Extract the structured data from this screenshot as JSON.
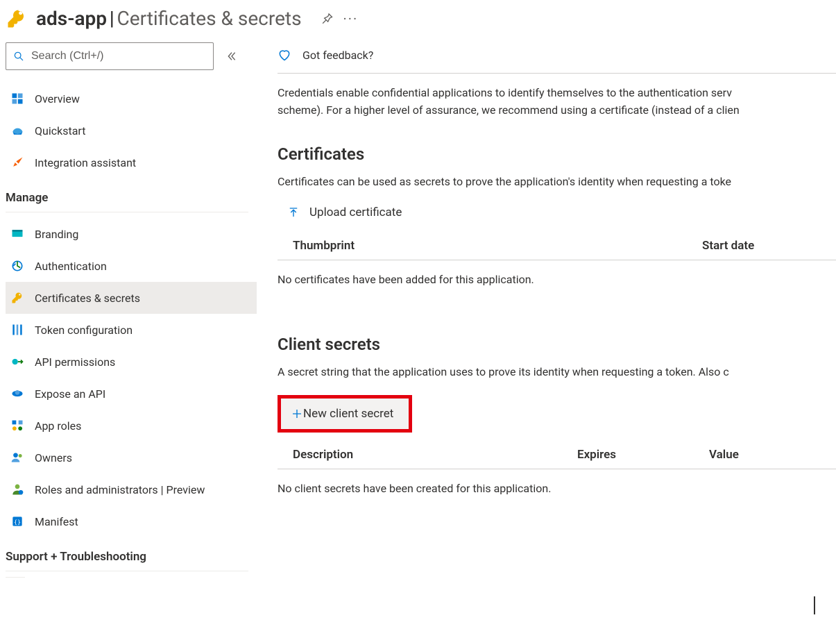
{
  "header": {
    "app_name": "ads-app",
    "page_title": "Certificates & secrets"
  },
  "sidebar": {
    "search_placeholder": "Search (Ctrl+/)",
    "top_items": [
      {
        "label": "Overview",
        "icon": "overview"
      },
      {
        "label": "Quickstart",
        "icon": "quickstart"
      },
      {
        "label": "Integration assistant",
        "icon": "rocket"
      }
    ],
    "manage_label": "Manage",
    "manage_items": [
      {
        "label": "Branding",
        "icon": "branding"
      },
      {
        "label": "Authentication",
        "icon": "auth"
      },
      {
        "label": "Certificates & secrets",
        "icon": "key",
        "active": true
      },
      {
        "label": "Token configuration",
        "icon": "token"
      },
      {
        "label": "API permissions",
        "icon": "apiperm"
      },
      {
        "label": "Expose an API",
        "icon": "expose"
      },
      {
        "label": "App roles",
        "icon": "approles"
      },
      {
        "label": "Owners",
        "icon": "owners"
      },
      {
        "label": "Roles and administrators | Preview",
        "icon": "roles"
      },
      {
        "label": "Manifest",
        "icon": "manifest"
      }
    ],
    "support_label": "Support + Troubleshooting"
  },
  "main": {
    "feedback_label": "Got feedback?",
    "intro_line1": "Credentials enable confidential applications to identify themselves to the authentication serv",
    "intro_line2": "scheme). For a higher level of assurance, we recommend using a certificate (instead of a clien",
    "certificates": {
      "title": "Certificates",
      "desc": "Certificates can be used as secrets to prove the application's identity when requesting a toke",
      "upload_label": "Upload certificate",
      "col_thumbprint": "Thumbprint",
      "col_startdate": "Start date",
      "empty": "No certificates have been added for this application."
    },
    "secrets": {
      "title": "Client secrets",
      "desc": "A secret string that the application uses to prove its identity when requesting a token. Also c",
      "new_label": "New client secret",
      "col_description": "Description",
      "col_expires": "Expires",
      "col_value": "Value",
      "empty": "No client secrets have been created for this application."
    }
  }
}
